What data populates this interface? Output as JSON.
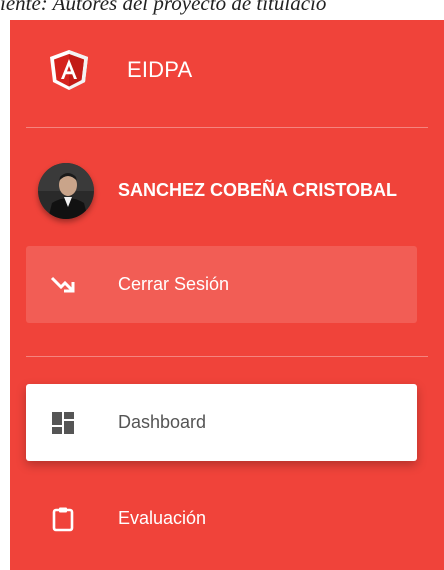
{
  "caption": "iente: Autores del proyecto de titulació",
  "brand": {
    "name": "EIDPA",
    "logo_letter": "A",
    "logo_icon": "angular-logo-icon"
  },
  "user": {
    "name": "SANCHEZ COBEÑA CRISTOBAL",
    "avatar_icon": "user-avatar"
  },
  "logout": {
    "label": "Cerrar Sesión",
    "icon": "trending-down-arrow-icon"
  },
  "nav": {
    "items": [
      {
        "label": "Dashboard",
        "icon": "dashboard-icon",
        "active": true
      },
      {
        "label": "Evaluación",
        "icon": "clipboard-icon",
        "active": false
      }
    ]
  },
  "colors": {
    "sidebar": "#f0433a",
    "active_bg": "#ffffff",
    "active_text": "#555555",
    "text": "#ffffff"
  }
}
